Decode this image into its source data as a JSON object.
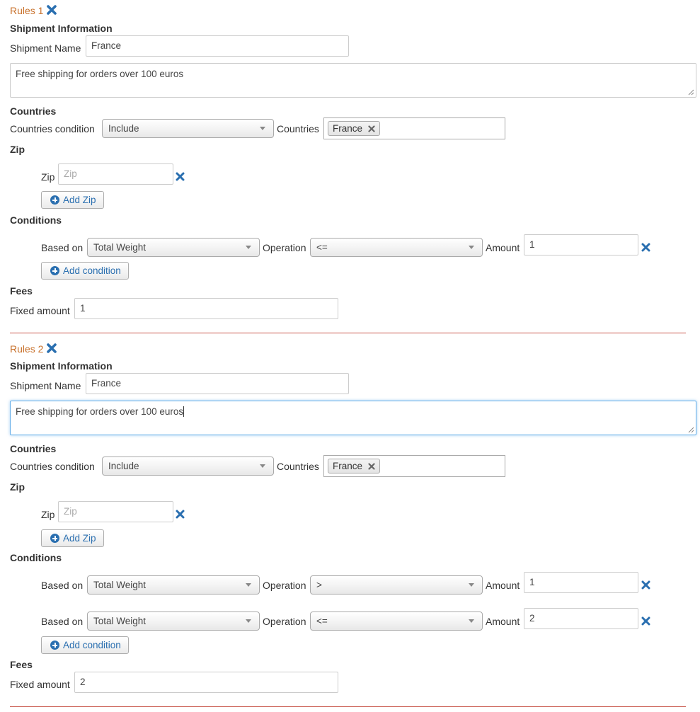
{
  "colors": {
    "rule_title": "#c8702a",
    "accent_blue": "#2a6fb0",
    "divider": "#c0392b",
    "focus": "#66afe9"
  },
  "labels": {
    "shipment_information": "Shipment Information",
    "shipment_name": "Shipment Name",
    "countries": "Countries",
    "countries_condition": "Countries condition",
    "countries_field": "Countries",
    "zip": "Zip",
    "zip_field": "Zip",
    "add_zip": "Add Zip",
    "conditions": "Conditions",
    "based_on": "Based on",
    "operation": "Operation",
    "amount": "Amount",
    "add_condition": "Add condition",
    "fees": "Fees",
    "fixed_amount": "Fixed amount"
  },
  "rules": [
    {
      "title": "Rules 1",
      "shipment_name": "France",
      "description": "Free shipping for orders over 100 euros",
      "countries_condition": "Include",
      "countries": [
        "France"
      ],
      "zip_placeholder": "Zip",
      "conditions": [
        {
          "based_on": "Total Weight",
          "operation": "<=",
          "amount": "1"
        }
      ],
      "fixed_amount": "1"
    },
    {
      "title": "Rules 2",
      "shipment_name": "France",
      "description": "Free shipping for orders over 100 euros",
      "countries_condition": "Include",
      "countries": [
        "France"
      ],
      "zip_placeholder": "Zip",
      "conditions": [
        {
          "based_on": "Total Weight",
          "operation": ">",
          "amount": "1"
        },
        {
          "based_on": "Total Weight",
          "operation": "<=",
          "amount": "2"
        }
      ],
      "fixed_amount": "2"
    }
  ]
}
